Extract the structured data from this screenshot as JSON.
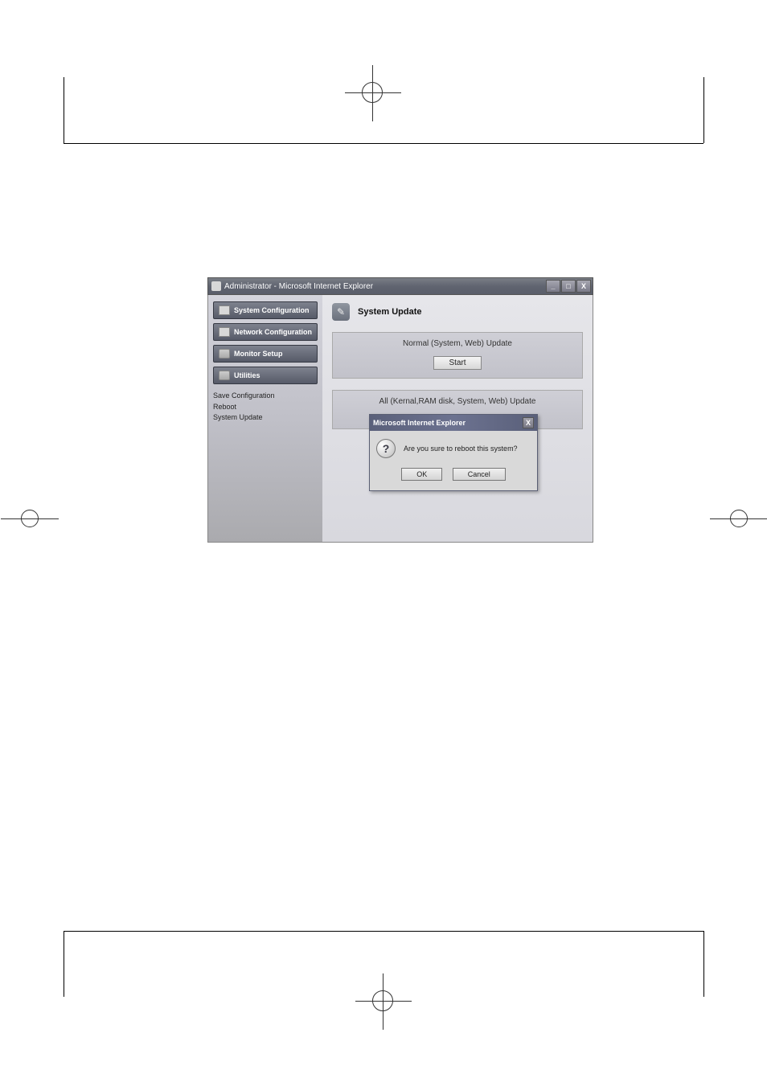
{
  "window": {
    "title": "Administrator - Microsoft Internet Explorer",
    "buttons": {
      "min": "_",
      "max": "□",
      "close": "X"
    }
  },
  "sidebar": {
    "nav": [
      {
        "label": "System Configuration"
      },
      {
        "label": "Network Configuration"
      },
      {
        "label": "Monitor Setup"
      },
      {
        "label": "Utilities"
      }
    ],
    "sublinks": [
      "Save Configuration",
      "Reboot",
      "System Update"
    ]
  },
  "content": {
    "header_icon": "✎",
    "title": "System Update",
    "panel1": {
      "label": "Normal (System, Web) Update",
      "button": "Start"
    },
    "panel2": {
      "label": "All (Kernal,RAM disk, System, Web) Update"
    }
  },
  "dialog": {
    "title": "Microsoft Internet Explorer",
    "icon": "?",
    "close": "X",
    "message": "Are you sure to reboot this system?",
    "ok": "OK",
    "cancel": "Cancel"
  }
}
